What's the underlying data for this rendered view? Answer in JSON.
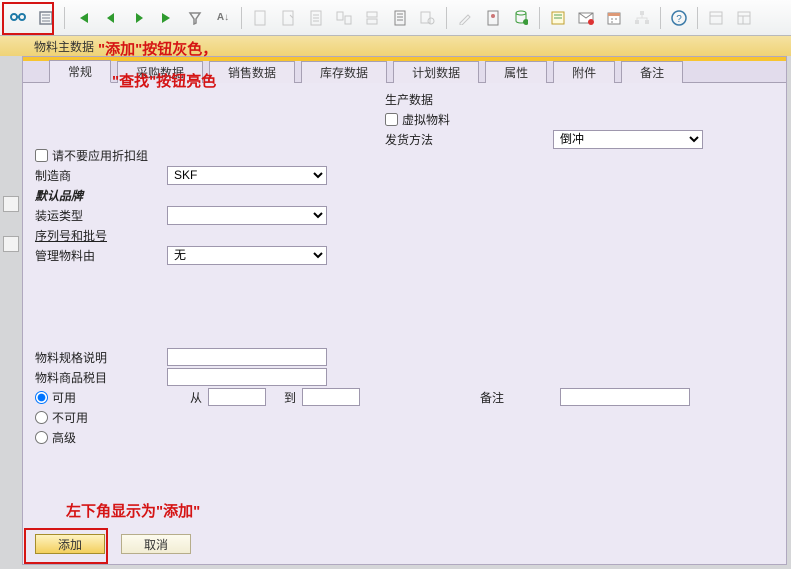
{
  "annotations": {
    "add_gray": "\"添加\"按钮灰色，",
    "find_bright": "\"查找\"按钮亮色",
    "bottom_left": "左下角显示为\"添加\""
  },
  "window_title": "物料主数据",
  "tabs": {
    "t0": "常规",
    "t1": "采购数据",
    "t2": "销售数据",
    "t3": "库存数据",
    "t4": "计划数据",
    "t5": "属性",
    "t6": "附件",
    "t7": "备注"
  },
  "labels": {
    "no_discount": "请不要应用折扣组",
    "manufacturer": "制造商",
    "default_brand": "默认品牌",
    "ship_type": "装运类型",
    "serial_batch": "序列号和批号",
    "manage_by": "管理物料由",
    "spec_desc": "物料规格说明",
    "tariff": "物料商品税目",
    "available": "可用",
    "unavailable": "不可用",
    "advanced": "高级",
    "from": "从",
    "to": "到",
    "remark": "备注",
    "prod_data": "生产数据",
    "virtual": "虚拟物料",
    "ship_method": "发货方法"
  },
  "values": {
    "manufacturer": "SKF",
    "manage_by": "无",
    "ship_method": "倒冲"
  },
  "buttons": {
    "add": "添加",
    "cancel": "取消"
  }
}
